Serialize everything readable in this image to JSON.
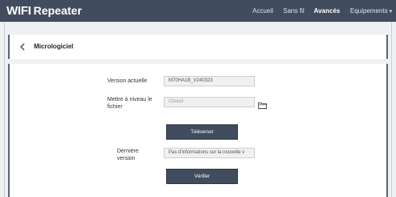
{
  "header": {
    "brand_strong": "WIFI",
    "brand_rest": "Repeater",
    "nav": [
      {
        "label": "Accueil",
        "active": false,
        "dropdown": false
      },
      {
        "label": "Sans fil",
        "active": false,
        "dropdown": false
      },
      {
        "label": "Avancés",
        "active": true,
        "dropdown": false
      },
      {
        "label": "Equipements",
        "active": false,
        "dropdown": true
      }
    ]
  },
  "page": {
    "title": "Micrologiciel"
  },
  "form": {
    "current_version_label": "Version actuelle",
    "current_version_value": "M70HA1B_V240323",
    "upgrade_label": "Mettre à niveau le fichier",
    "file_placeholder": "Choisir",
    "upload_button": "Téléverser",
    "latest_version_label": "Dernière version",
    "latest_version_value": "Pas d'informations sur la nouvelle v",
    "check_button": "Vérifier"
  },
  "colors": {
    "topbar": "#414c5e",
    "button": "#414c5e",
    "page_background": "#eef0f3"
  },
  "icons": [
    "chevron-left-icon",
    "folder-icon"
  ]
}
